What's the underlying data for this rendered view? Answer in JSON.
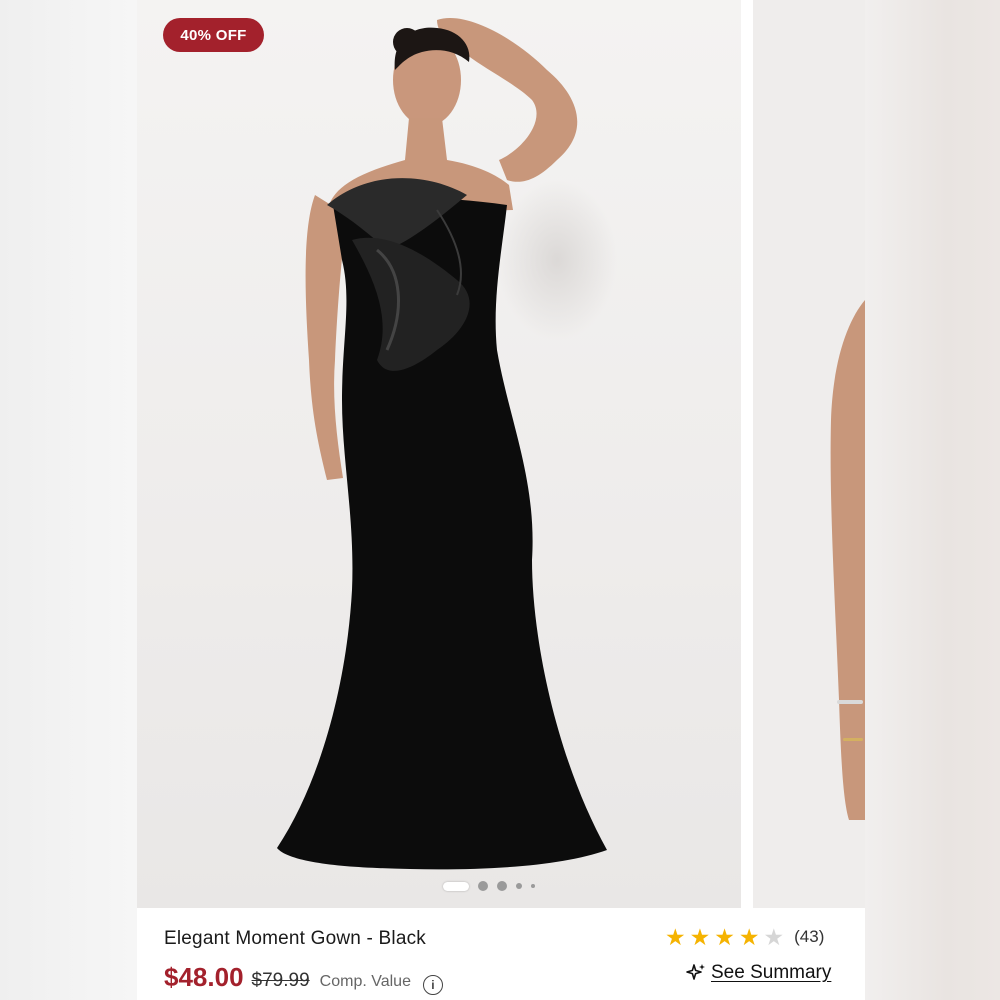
{
  "badge": {
    "label": "40% OFF",
    "color": "#a3212c"
  },
  "product": {
    "title": "Elegant Moment Gown - Black",
    "price": "$48.00",
    "original_price": "$79.99",
    "comp_label": "Comp. Value",
    "image_alt": "Model wearing black strapless gown with satin bow"
  },
  "rating": {
    "stars": 4,
    "max": 5,
    "count": "(43)"
  },
  "summary": {
    "label": "See Summary"
  },
  "gallery": {
    "slides": 5,
    "active": 1
  },
  "icons": {
    "share": "share-icon",
    "info": "info-icon",
    "sparkle": "sparkle-icon",
    "star": "star-icon"
  }
}
